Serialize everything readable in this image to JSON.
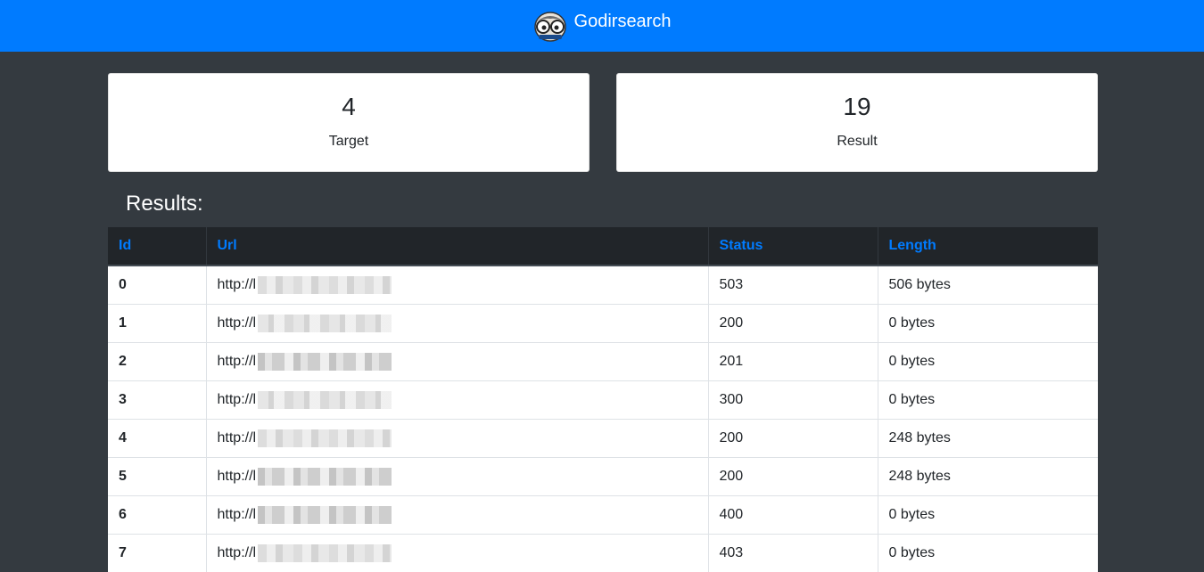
{
  "navbar": {
    "brand": "Godirsearch",
    "logo_icon": "gopher-logo-icon"
  },
  "cards": {
    "target": {
      "value": "4",
      "label": "Target"
    },
    "result": {
      "value": "19",
      "label": "Result"
    }
  },
  "results": {
    "title": "Results:",
    "columns": [
      "Id",
      "Url",
      "Status",
      "Length"
    ],
    "rows": [
      {
        "id": "0",
        "url": "http://l",
        "status": "503",
        "length": "506 bytes"
      },
      {
        "id": "1",
        "url": "http://l",
        "status": "200",
        "length": "0 bytes"
      },
      {
        "id": "2",
        "url": "http://l",
        "status": "201",
        "length": "0 bytes"
      },
      {
        "id": "3",
        "url": "http://l",
        "status": "300",
        "length": "0 bytes"
      },
      {
        "id": "4",
        "url": "http://l",
        "status": "200",
        "length": "248 bytes"
      },
      {
        "id": "5",
        "url": "http://l",
        "status": "200",
        "length": "248 bytes"
      },
      {
        "id": "6",
        "url": "http://l",
        "status": "400",
        "length": "0 bytes"
      },
      {
        "id": "7",
        "url": "http://l",
        "status": "403",
        "length": "0 bytes"
      }
    ]
  },
  "colors": {
    "navbar": "#007bff",
    "background": "#343a40",
    "header_link": "#007bff"
  }
}
